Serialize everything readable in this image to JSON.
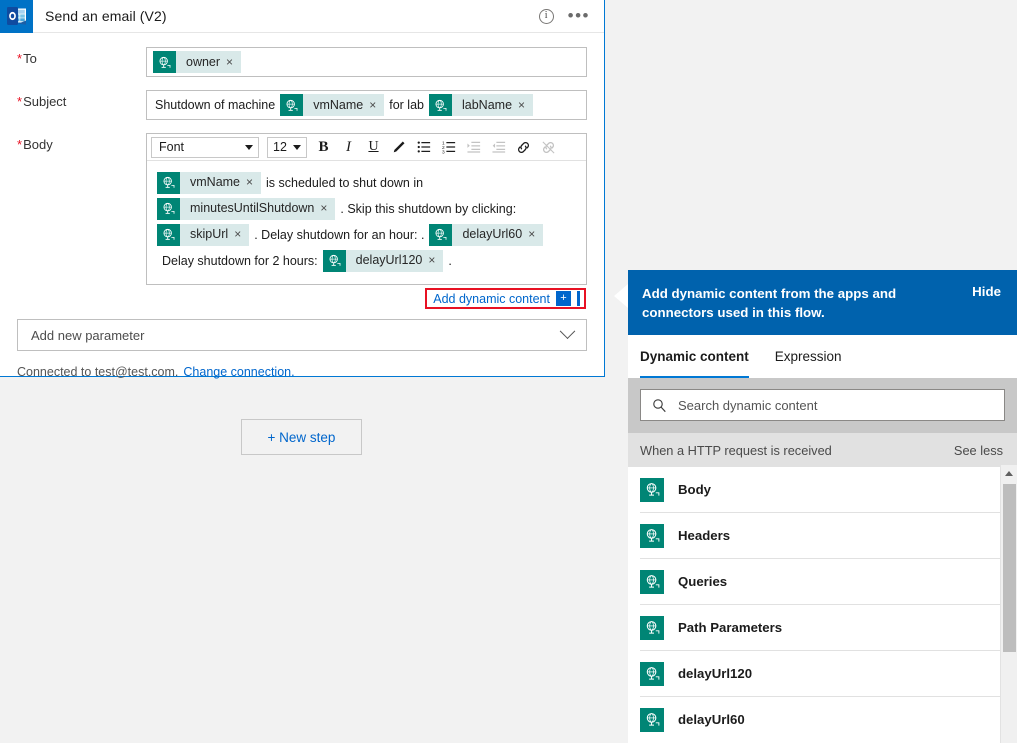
{
  "card": {
    "app_icon": "outlook-icon",
    "title": "Send an email (V2)",
    "info_icon": "info-icon",
    "more_icon": "ellipsis-icon",
    "fields": {
      "to": {
        "label": "To",
        "required_mark": "*",
        "tokens": [
          {
            "label": "owner",
            "remove": "×"
          }
        ]
      },
      "subject": {
        "label": "Subject",
        "required_mark": "*",
        "parts": [
          {
            "type": "text",
            "value": "Shutdown of machine"
          },
          {
            "type": "token",
            "label": "vmName",
            "remove": "×"
          },
          {
            "type": "text",
            "value": "for lab"
          },
          {
            "type": "token",
            "label": "labName",
            "remove": "×"
          }
        ]
      },
      "body": {
        "label": "Body",
        "required_mark": "*",
        "toolbar": {
          "font_name": "Font",
          "font_size": "12",
          "bold": "B",
          "italic": "I",
          "underline": "U",
          "highlight_icon": "pen-highlight-icon",
          "bullet_list_icon": "bulleted-list-icon",
          "numbered_list_icon": "numbered-list-icon",
          "indent_icon": "increase-indent-icon",
          "outdent_icon": "decrease-indent-icon",
          "link_icon": "insert-link-icon",
          "unlink_icon": "remove-link-icon"
        },
        "content": [
          {
            "type": "token",
            "label": "vmName",
            "remove": "×"
          },
          {
            "type": "text",
            "value": "is scheduled to shut down in"
          },
          {
            "type": "token",
            "label": "minutesUntilShutdown",
            "remove": "×"
          },
          {
            "type": "text",
            "value": ". Skip this shutdown by clicking:"
          },
          {
            "type": "token",
            "label": "skipUrl",
            "remove": "×"
          },
          {
            "type": "text",
            "value": ". Delay shutdown for an hour: ."
          },
          {
            "type": "token",
            "label": "delayUrl60",
            "remove": "×"
          },
          {
            "type": "text",
            "value": "Delay shutdown for 2 hours:"
          },
          {
            "type": "token",
            "label": "delayUrl120",
            "remove": "×"
          },
          {
            "type": "text",
            "value": "."
          }
        ]
      }
    },
    "add_dynamic_content": {
      "label": "Add dynamic content",
      "plus": "+"
    },
    "add_new_parameter": "Add new parameter",
    "connection": {
      "text": "Connected to test@test.com.",
      "change_link": "Change connection."
    }
  },
  "canvas": {
    "new_step_button": "+ New step"
  },
  "dynamic_panel": {
    "header_text": "Add dynamic content from the apps and connectors used in this flow.",
    "hide_label": "Hide",
    "tabs": [
      {
        "label": "Dynamic content",
        "active": true
      },
      {
        "label": "Expression",
        "active": false
      }
    ],
    "search_placeholder": "Search dynamic content",
    "search_icon": "search-icon",
    "group": {
      "title": "When a HTTP request is received",
      "toggle_label": "See less"
    },
    "items": [
      {
        "label": "Body"
      },
      {
        "label": "Headers"
      },
      {
        "label": "Queries"
      },
      {
        "label": "Path Parameters"
      },
      {
        "label": "delayUrl120"
      },
      {
        "label": "delayUrl60"
      }
    ]
  },
  "colors": {
    "accent_blue": "#0078d4",
    "panel_header_blue": "#0062ad",
    "token_teal": "#008575",
    "token_chip_bg": "#d9e9e9",
    "link_blue": "#0066cc",
    "highlight_red": "#e81123",
    "outlook_blue": "#0072c6"
  }
}
